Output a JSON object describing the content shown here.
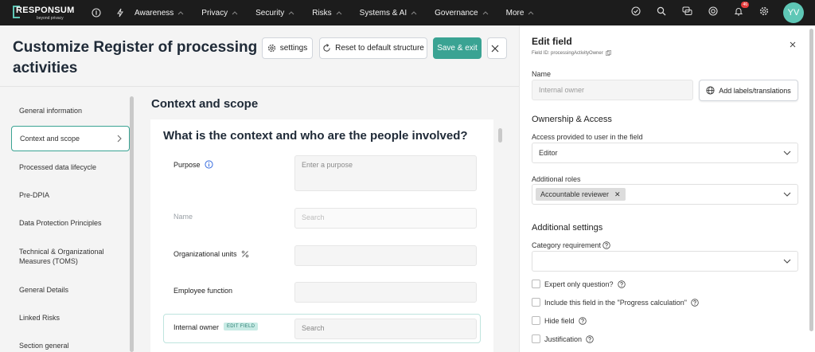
{
  "brand": {
    "name": "RESPONSUM",
    "tagline": "beyond privacy"
  },
  "topnav": {
    "items": [
      {
        "label": "Awareness"
      },
      {
        "label": "Privacy"
      },
      {
        "label": "Security"
      },
      {
        "label": "Risks"
      },
      {
        "label": "Systems & AI"
      },
      {
        "label": "Governance"
      },
      {
        "label": "More"
      }
    ],
    "notification_count": "46",
    "avatar_initials": "YV"
  },
  "header": {
    "title": "Customize Register of processing activities",
    "settings_label": "settings",
    "reset_label": "Reset to default structure",
    "save_label": "Save & exit"
  },
  "sidebar": {
    "items": [
      {
        "label": "General information"
      },
      {
        "label": "Context and scope"
      },
      {
        "label": "Processed data lifecycle"
      },
      {
        "label": "Pre-DPIA"
      },
      {
        "label": "Data Protection Principles"
      },
      {
        "label": "Technical & Organizational Measures (TOMS)"
      },
      {
        "label": "General Details"
      },
      {
        "label": "Linked Risks"
      },
      {
        "label": "Section general"
      }
    ]
  },
  "main": {
    "section_title": "Context and scope",
    "question": "What is the context and who are the people involved?",
    "fields": {
      "purpose": {
        "label": "Purpose",
        "placeholder": "Enter a purpose"
      },
      "name": {
        "label": "Name",
        "placeholder": "Search"
      },
      "org_units": {
        "label": "Organizational units"
      },
      "employee_function": {
        "label": "Employee function"
      },
      "internal_owner": {
        "label": "Internal owner",
        "badge": "EDIT FIELD",
        "placeholder": "Search"
      }
    }
  },
  "panel": {
    "title": "Edit field",
    "field_id": "Field ID: processingActivityOwner",
    "name_label": "Name",
    "name_value": "Internal owner",
    "add_labels_button": "Add labels/translations",
    "ownership_heading": "Ownership & Access",
    "access_label": "Access provided to user in the field",
    "access_value": "Editor",
    "roles_label": "Additional roles",
    "role_chip": "Accountable reviewer",
    "additional_heading": "Additional settings",
    "category_label": "Category requirement",
    "checkboxes": [
      {
        "label": "Expert only question?"
      },
      {
        "label": "Include this field in the \"Progress calculation\""
      },
      {
        "label": "Hide field"
      },
      {
        "label": "Justification"
      }
    ]
  },
  "colors": {
    "accent": "#3aa393",
    "nav_bg": "#1c1c1c",
    "badge": "#e63b3b"
  }
}
